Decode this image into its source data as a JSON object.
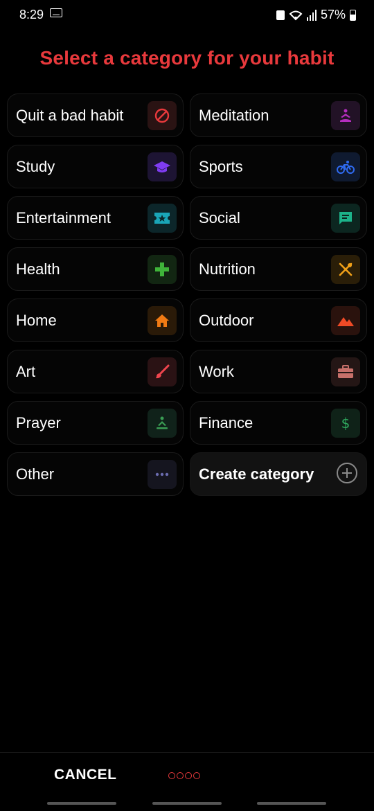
{
  "status_bar": {
    "time": "8:29",
    "battery": "57%",
    "icons": [
      "keyboard-icon",
      "lock-icon",
      "wifi-icon",
      "signal-icon",
      "battery-icon"
    ]
  },
  "title": "Select a category for your habit",
  "colors": {
    "accent": "#e8393c",
    "background": "#000000"
  },
  "categories": [
    {
      "label": "Quit a bad habit",
      "icon": "block-icon",
      "color": "#e8393c"
    },
    {
      "label": "Meditation",
      "icon": "meditation-icon",
      "color": "#b62dbf"
    },
    {
      "label": "Study",
      "icon": "graduation-cap-icon",
      "color": "#7f3cf2"
    },
    {
      "label": "Sports",
      "icon": "bicycle-icon",
      "color": "#2f6bf2"
    },
    {
      "label": "Entertainment",
      "icon": "ticket-icon",
      "color": "#1aa6b8"
    },
    {
      "label": "Social",
      "icon": "chat-icon",
      "color": "#1cb38a"
    },
    {
      "label": "Health",
      "icon": "plus-cross-icon",
      "color": "#3fb43a"
    },
    {
      "label": "Nutrition",
      "icon": "utensils-icon",
      "color": "#f0a018"
    },
    {
      "label": "Home",
      "icon": "home-icon",
      "color": "#f07a14"
    },
    {
      "label": "Outdoor",
      "icon": "mountain-icon",
      "color": "#f04a26"
    },
    {
      "label": "Art",
      "icon": "brush-icon",
      "color": "#f0454e"
    },
    {
      "label": "Work",
      "icon": "briefcase-icon",
      "color": "#c7706a"
    },
    {
      "label": "Prayer",
      "icon": "prayer-icon",
      "color": "#3a9d54"
    },
    {
      "label": "Finance",
      "icon": "dollar-icon",
      "color": "#2fa85e"
    },
    {
      "label": "Other",
      "icon": "more-icon",
      "color": "#6b6cb0"
    }
  ],
  "create": {
    "label": "Create category",
    "icon": "add-circle-icon"
  },
  "bottom": {
    "cancel_label": "CANCEL",
    "step_dots": 4
  }
}
